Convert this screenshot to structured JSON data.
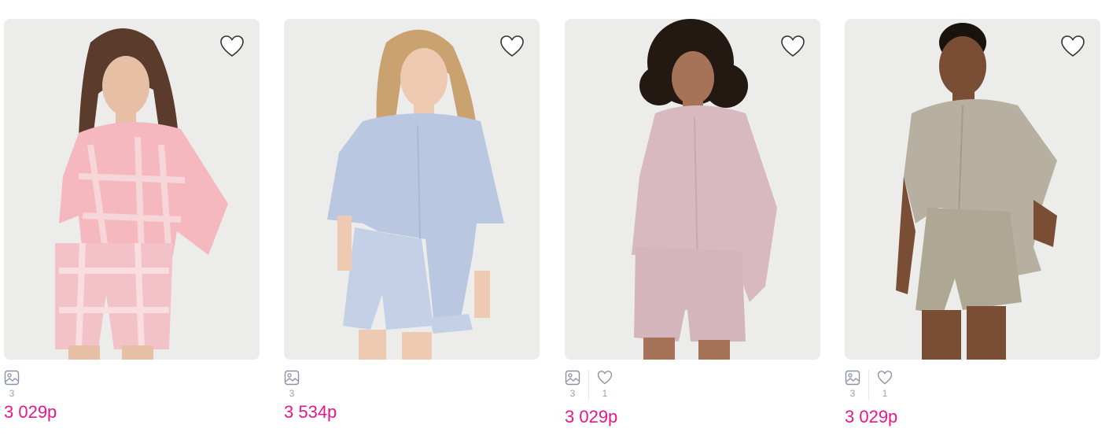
{
  "products": [
    {
      "name": "plaid-pajama-set",
      "price": "3 029р",
      "photos_count": "3",
      "likes_count": null,
      "colors": {
        "bg": "#ececeb",
        "shirt": "#f4b8be",
        "accent": "#f7d6da",
        "skin": "#e6bfa4",
        "hair": "#5a3b2c"
      }
    },
    {
      "name": "blue-pajama-set",
      "price": "3 534р",
      "photos_count": "3",
      "likes_count": null,
      "colors": {
        "bg": "#ececeb",
        "shirt": "#b9c8e0",
        "accent": "#c8d4e8",
        "skin": "#edcab1",
        "hair": "#c9a270"
      }
    },
    {
      "name": "mauve-pajama-set",
      "price": "3 029р",
      "photos_count": "3",
      "likes_count": "1",
      "colors": {
        "bg": "#ececeb",
        "shirt": "#d8b9c0",
        "accent": "#c9a8b0",
        "skin": "#a67358",
        "hair": "#241812"
      }
    },
    {
      "name": "olive-pajama-set",
      "price": "3 029р",
      "photos_count": "3",
      "likes_count": "1",
      "colors": {
        "bg": "#ececeb",
        "shirt": "#b7b0a0",
        "accent": "#a39b8a",
        "skin": "#7a4e35",
        "hair": "#1a120c"
      }
    }
  ],
  "theme": {
    "price_color": "#e5178a",
    "meta_color": "#9aa0b5"
  },
  "icons": {
    "favorite": "heart-outline-icon",
    "photos": "image-icon",
    "likes": "heart-icon"
  }
}
